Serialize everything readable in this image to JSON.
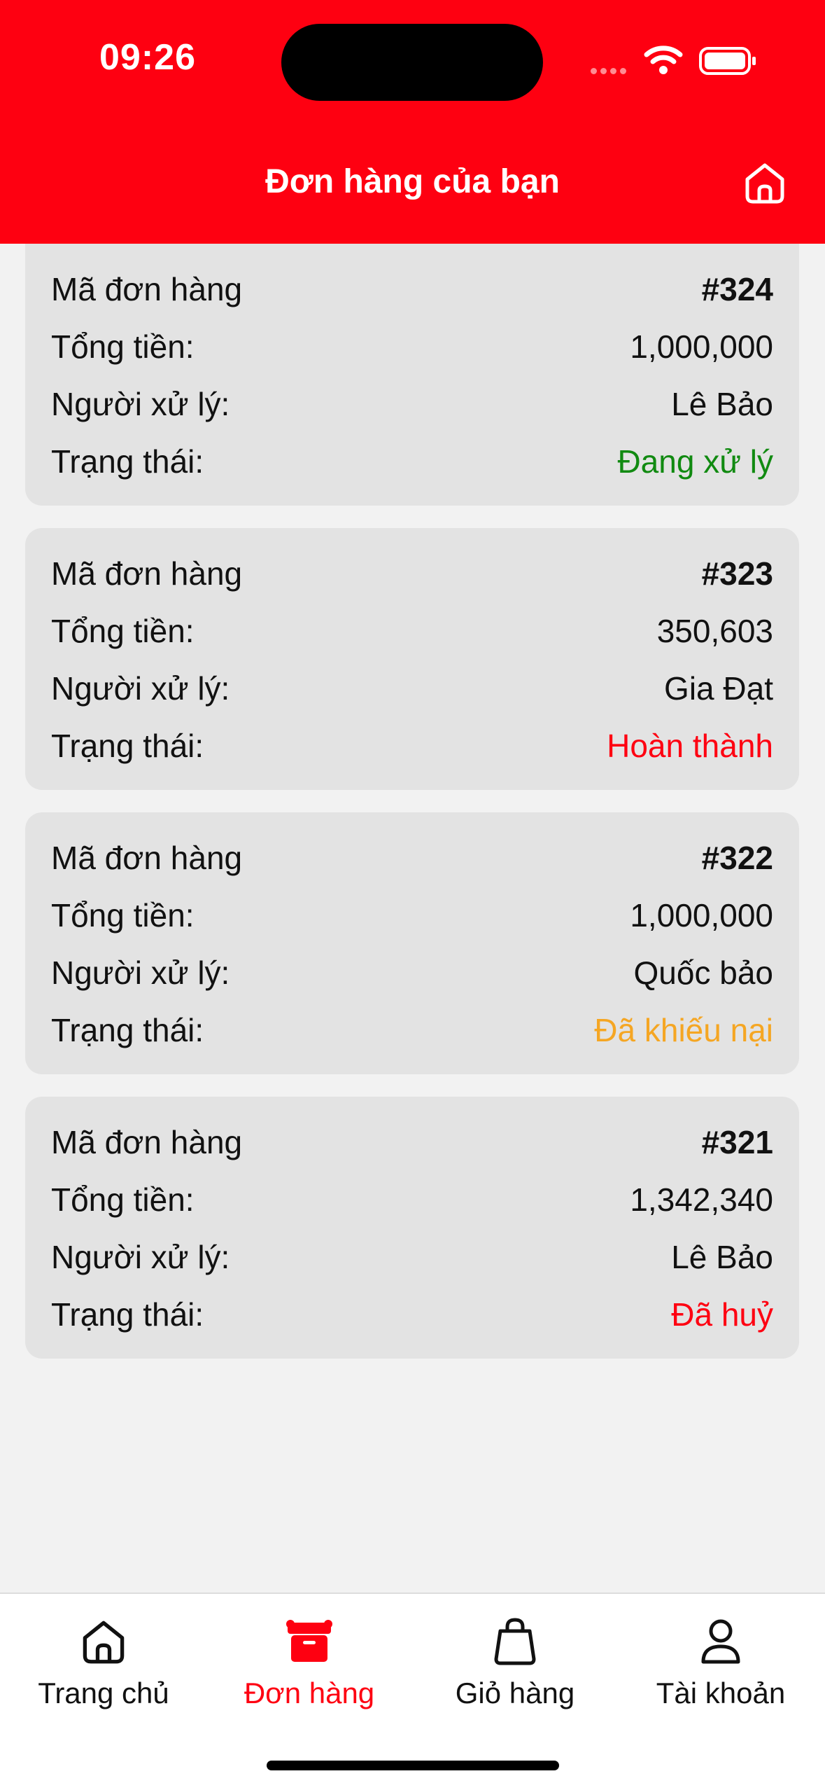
{
  "status": {
    "time": "09:26"
  },
  "header": {
    "title": "Đơn hàng của bạn",
    "home_icon": "home-icon"
  },
  "colors": {
    "brand": "#fe0011",
    "status_processing": "#118a11",
    "status_done": "#fe0011",
    "status_complaint": "#f5a623",
    "status_cancelled": "#fe0011"
  },
  "labels": {
    "order_code": "Mã đơn hàng",
    "total": "Tổng tiền:",
    "handler": "Người xử lý:",
    "status": "Trạng thái:"
  },
  "orders": [
    {
      "code": "#324",
      "total": "1,000,000",
      "handler": "Lê Bảo",
      "status": "Đang xử lý",
      "status_color": "#118a11"
    },
    {
      "code": "#323",
      "total": "350,603",
      "handler": "Gia Đạt",
      "status": "Hoàn thành",
      "status_color": "#fe0011"
    },
    {
      "code": "#322",
      "total": "1,000,000",
      "handler": "Quốc bảo",
      "status": "Đã khiếu nại",
      "status_color": "#f5a623"
    },
    {
      "code": "#321",
      "total": "1,342,340",
      "handler": "Lê Bảo",
      "status": "Đã huỷ",
      "status_color": "#fe0011"
    }
  ],
  "tabbar": {
    "items": [
      {
        "label": "Trang chủ",
        "icon": "home-icon"
      },
      {
        "label": "Đơn hàng",
        "icon": "box-icon",
        "active": true
      },
      {
        "label": "Giỏ hàng",
        "icon": "shopping-bag-icon"
      },
      {
        "label": "Tài khoản",
        "icon": "user-icon"
      }
    ]
  }
}
